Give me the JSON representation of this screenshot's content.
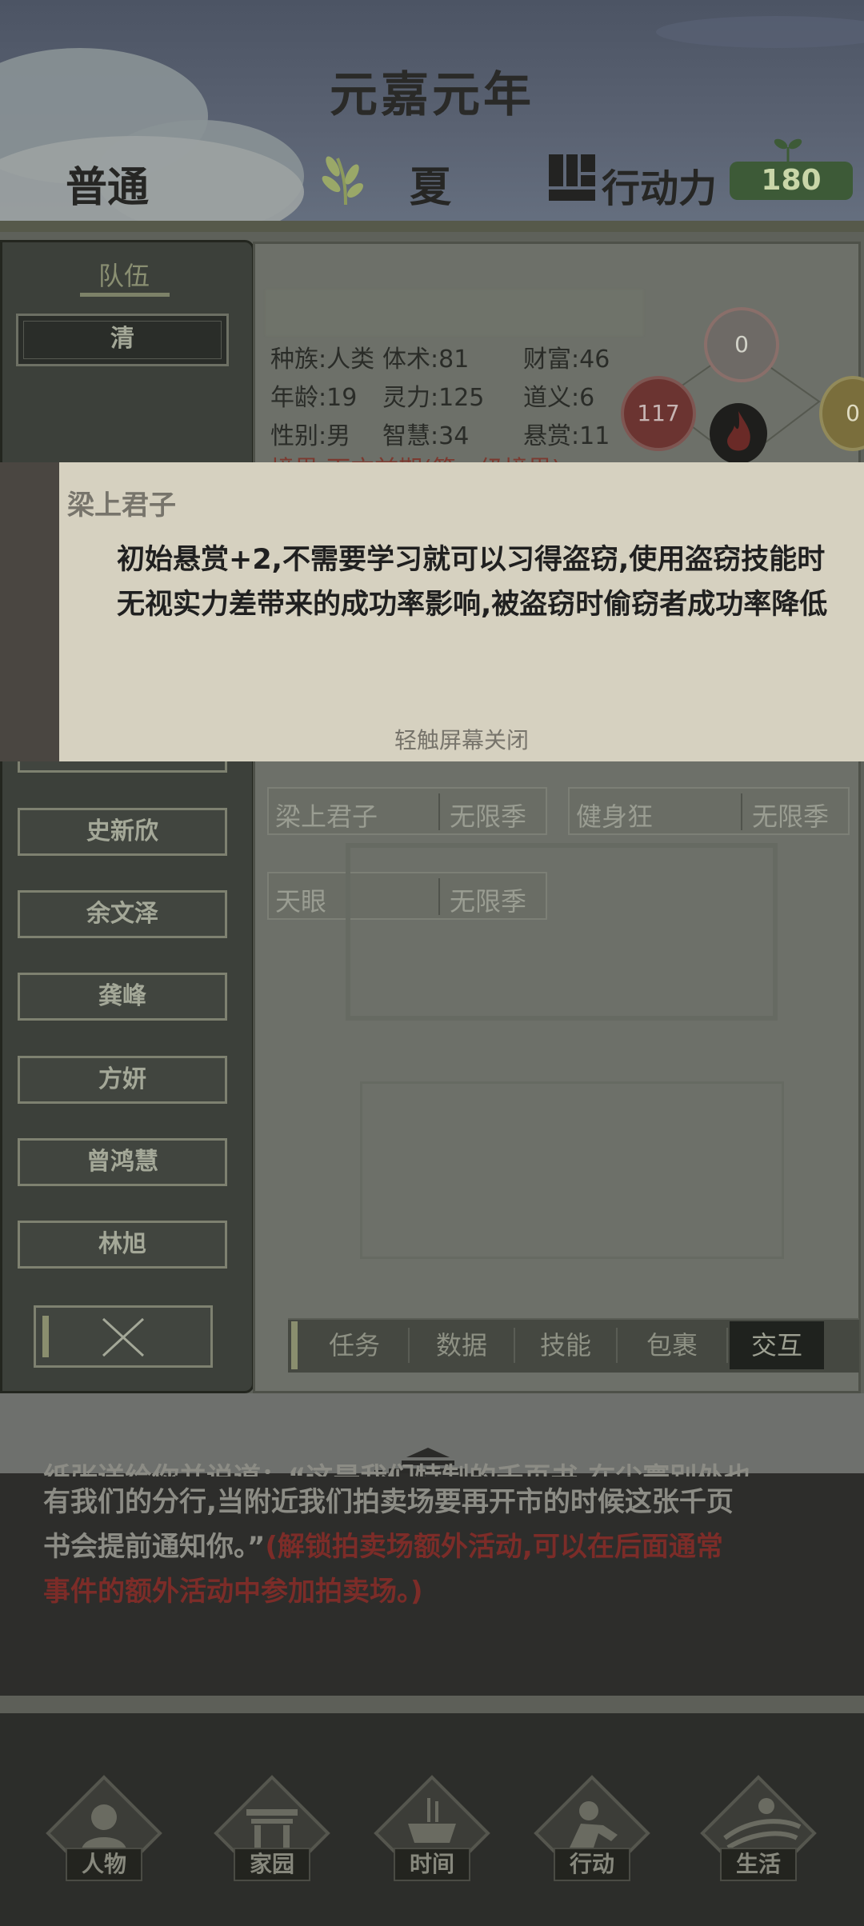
{
  "header": {
    "year": "元嘉元年",
    "difficulty": "普通",
    "season": "夏",
    "ap_label": "行动力",
    "ap_value": "180"
  },
  "team": {
    "title": "队伍",
    "members": [
      "清",
      "史新欣",
      "余文泽",
      "龚峰",
      "方妍",
      "曾鸿慧",
      "林旭"
    ]
  },
  "character": {
    "stats": {
      "race": "种族:人类",
      "body": "体术:81",
      "wealth": "财富:46",
      "age": "年龄:19",
      "spirit": "灵力:125",
      "morality": "道义:6",
      "gender": "性别:男",
      "wisdom": "智慧:34",
      "bounty": "悬赏:11",
      "realm_partial": "境界:下方前期(第一级境界)"
    },
    "circles": {
      "top": "0",
      "left": "117",
      "right": "0"
    }
  },
  "traits": [
    {
      "name": "梁上君子",
      "duration": "无限季"
    },
    {
      "name": "健身狂",
      "duration": "无限季"
    },
    {
      "name": "天眼",
      "duration": "无限季"
    }
  ],
  "tabs": [
    "任务",
    "数据",
    "技能",
    "包裹",
    "交互"
  ],
  "popup": {
    "title": "梁上君子",
    "description": "初始悬赏+2,不需要学习就可以习得盗窃,使用盗窃技能时无视实力差带来的成功率影响,被盗窃时偷窃者成功率降低",
    "hint": "轻触屏幕关闭"
  },
  "story": {
    "line1": "纸张送给你并说道：“这是我们特制的千页书,在尘寰别处也",
    "line2": "有我们的分行,当附近我们拍卖场要再开市的时候这张千页",
    "line3_plain": "书会提前通知你。”",
    "line3_highlight": "(解锁拍卖场额外活动,可以在后面通常",
    "line4_highlight": "事件的额外活动中参加拍卖场。)"
  },
  "nav": [
    "人物",
    "家园",
    "时间",
    "行动",
    "生活"
  ],
  "colors": {
    "accent_green": "#3d5a37",
    "highlight_red": "#7c2c28",
    "popup_bg": "#d6d1c0"
  },
  "icons": [
    "wheat-icon",
    "action-points-icon",
    "sprout-icon",
    "close-x-icon",
    "fire-icon",
    "person-icon",
    "house-icon",
    "time-icon",
    "action-icon",
    "life-icon"
  ]
}
